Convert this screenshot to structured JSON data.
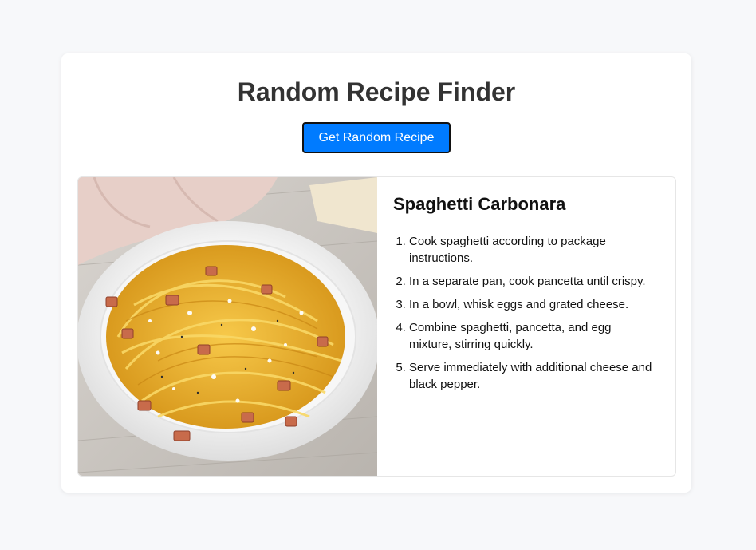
{
  "app": {
    "title": "Random Recipe Finder",
    "button_label": "Get Random Recipe"
  },
  "recipe": {
    "name": "Spaghetti Carbonara",
    "image_subject": "Plate of spaghetti carbonara with pancetta and grated cheese",
    "steps": [
      "Cook spaghetti according to package instructions.",
      "In a separate pan, cook pancetta until crispy.",
      "In a bowl, whisk eggs and grated cheese.",
      "Combine spaghetti, pancetta, and egg mixture, stirring quickly.",
      "Serve immediately with additional cheese and black pepper."
    ]
  },
  "colors": {
    "page_background": "#f7f8fa",
    "card_background": "#ffffff",
    "accent": "#007bff",
    "title_text": "#333333"
  }
}
